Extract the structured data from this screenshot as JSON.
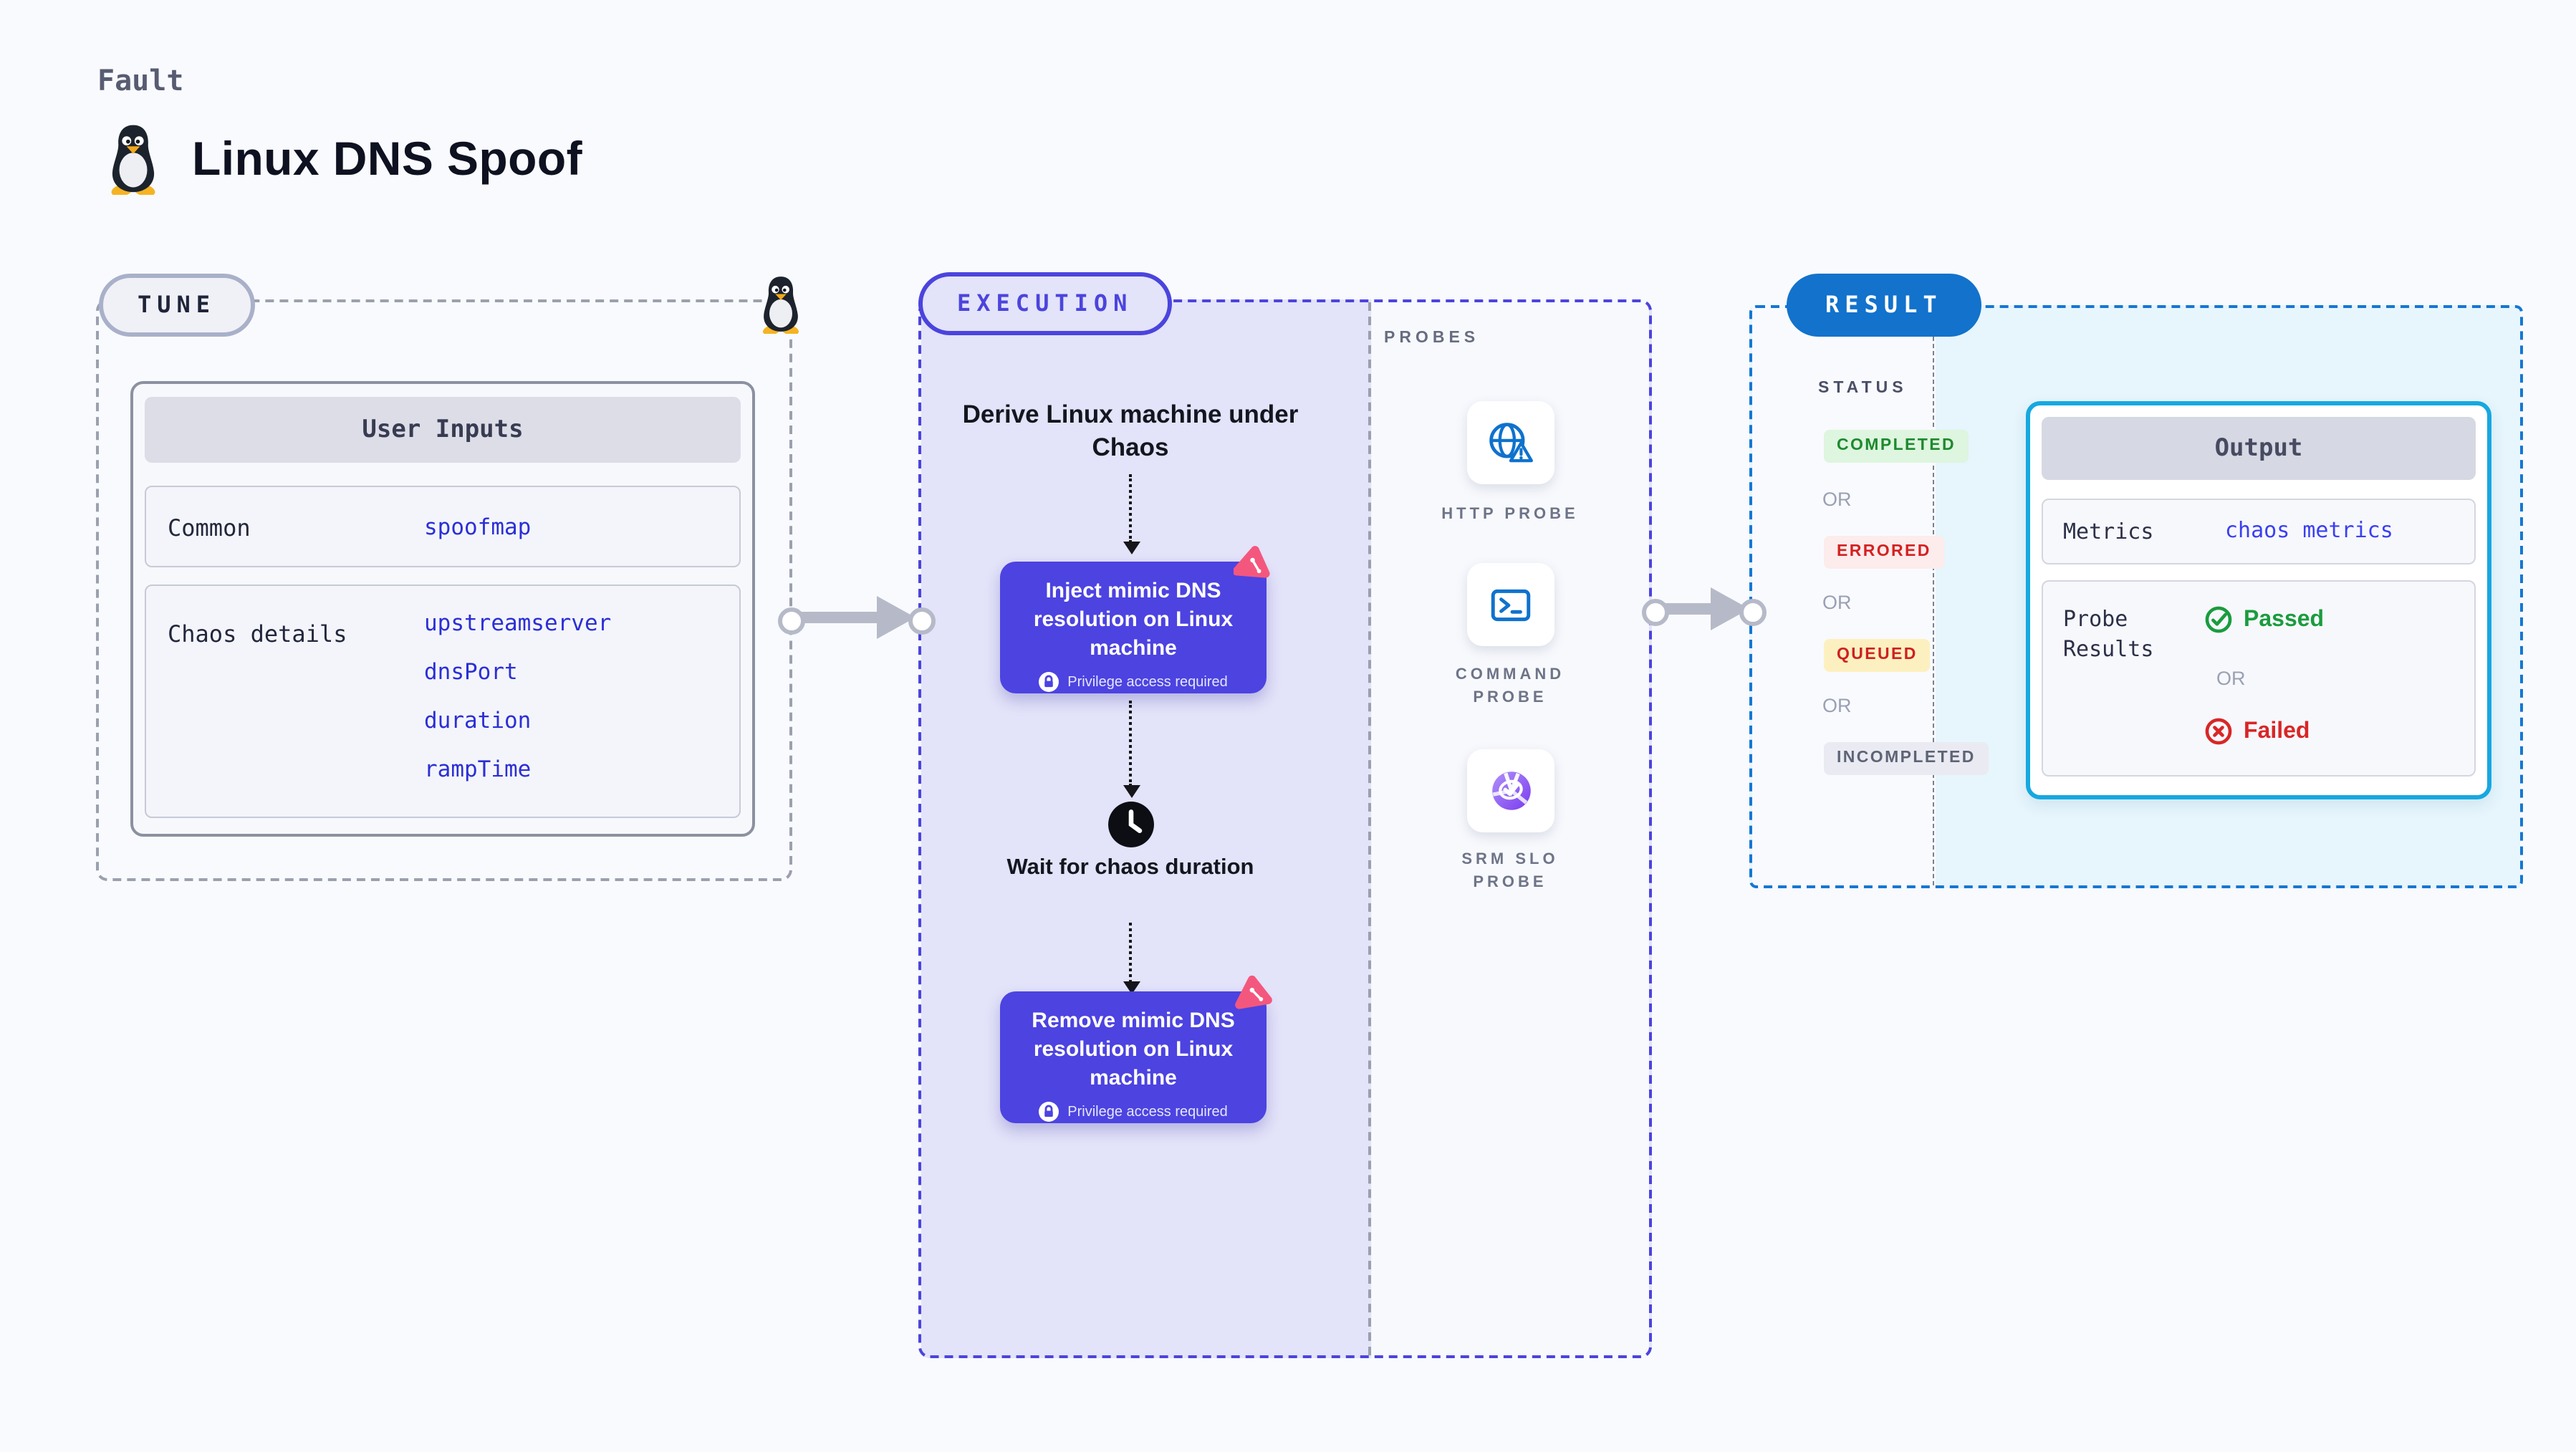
{
  "header": {
    "category": "Fault",
    "title": "Linux DNS Spoof"
  },
  "tune": {
    "pill": "TUNE",
    "card": {
      "title": "User Inputs",
      "rows": [
        {
          "label": "Common",
          "values": [
            "spoofmap"
          ]
        },
        {
          "label": "Chaos details",
          "values": [
            "upstreamserver",
            "dnsPort",
            "duration",
            "rampTime"
          ]
        }
      ]
    }
  },
  "execution": {
    "pill": "EXECUTION",
    "derive_text": "Derive Linux machine under Chaos",
    "inject_text": "Inject mimic DNS resolution on Linux machine",
    "wait_text": "Wait for chaos duration",
    "remove_text": "Remove mimic DNS resolution on Linux machine",
    "privilege_note": "Privilege access required"
  },
  "probes": {
    "heading": "PROBES",
    "items": [
      {
        "label": "HTTP PROBE",
        "icon": "globe-alert-icon"
      },
      {
        "label": "COMMAND PROBE",
        "icon": "terminal-icon"
      },
      {
        "label": "SRM SLO PROBE",
        "icon": "slo-pie-icon"
      }
    ]
  },
  "result": {
    "pill": "RESULT",
    "status_heading": "STATUS",
    "or_label": "OR",
    "statuses": [
      "COMPLETED",
      "ERRORED",
      "QUEUED",
      "INCOMPLETED"
    ],
    "output": {
      "title": "Output",
      "metrics_label": "Metrics",
      "metrics_value": "chaos metrics",
      "probe_label": "Probe Results",
      "passed": "Passed",
      "failed": "Failed"
    }
  },
  "colors": {
    "page_bg": "#f9fafd",
    "accent_indigo": "#4b44dd",
    "node_fill": "#4c43e1",
    "lavender_bg": "#e3e3f9",
    "pink_icon": "#f4577d",
    "result_blue": "#1272cc",
    "output_border_cyan": "#16a8e0",
    "output_panel_bg": "#e7f5fc",
    "probe_icon_blue": "#0f72cd",
    "srm_purple": "#7b3df0",
    "value_blue": "#2b2fd6",
    "passed_green": "#1a9c3e",
    "failed_red": "#d92626",
    "completed_green": "#1d8a2e",
    "errored_red": "#d32222",
    "queued_red": "#cf2020",
    "incompleted_gray": "#5e6476",
    "arrow_gray": "#b6bac8"
  }
}
